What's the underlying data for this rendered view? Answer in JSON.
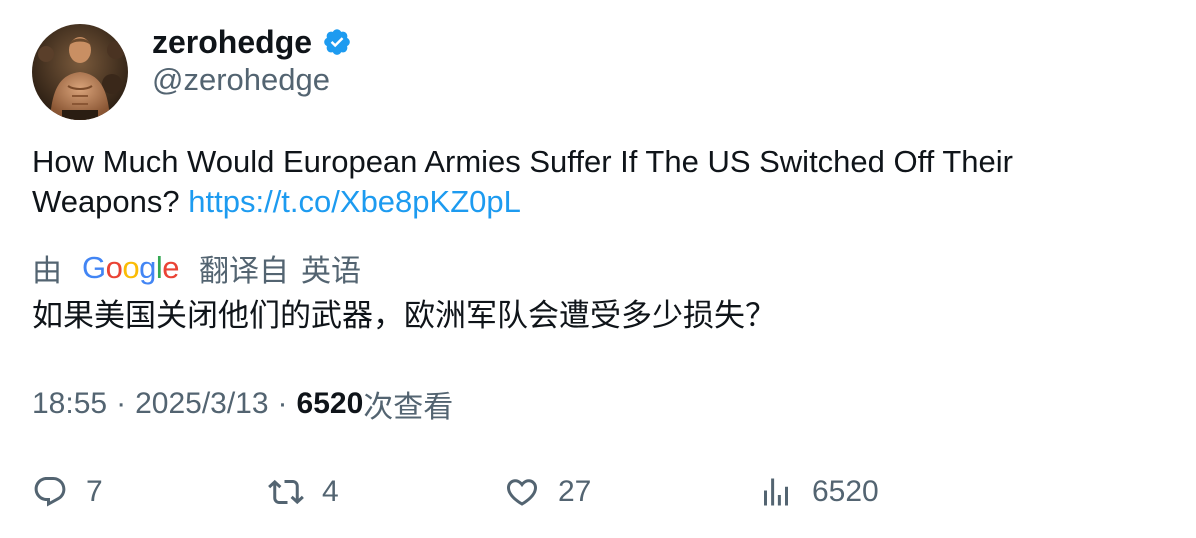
{
  "author": {
    "display_name": "zerohedge",
    "handle": "@zerohedge",
    "verified": true,
    "avatar_icon": "avatar-photo"
  },
  "tweet": {
    "text": "How Much Would European Armies Suffer If The US Switched Off Their Weapons? ",
    "link_text": "https://t.co/Xbe8pKZ0pL"
  },
  "translation": {
    "by_label": "由",
    "provider": "Google",
    "from_label": "翻译自",
    "language": "英语",
    "text": "如果美国关闭他们的武器，欧洲军队会遭受多少损失？"
  },
  "meta": {
    "time": "18:55",
    "separator": "·",
    "date": "2025/3/13",
    "views_count": "6520",
    "views_label": "次查看"
  },
  "actions": {
    "reply_count": "7",
    "retweet_count": "4",
    "like_count": "27",
    "analytics_count": "6520"
  },
  "colors": {
    "text": "#0f1419",
    "secondary": "#536471",
    "link": "#1d9bf0",
    "verified": "#1d9bf0",
    "google_blue": "#4285F4",
    "google_red": "#EA4335",
    "google_yellow": "#FBBC05",
    "google_green": "#34A853"
  }
}
